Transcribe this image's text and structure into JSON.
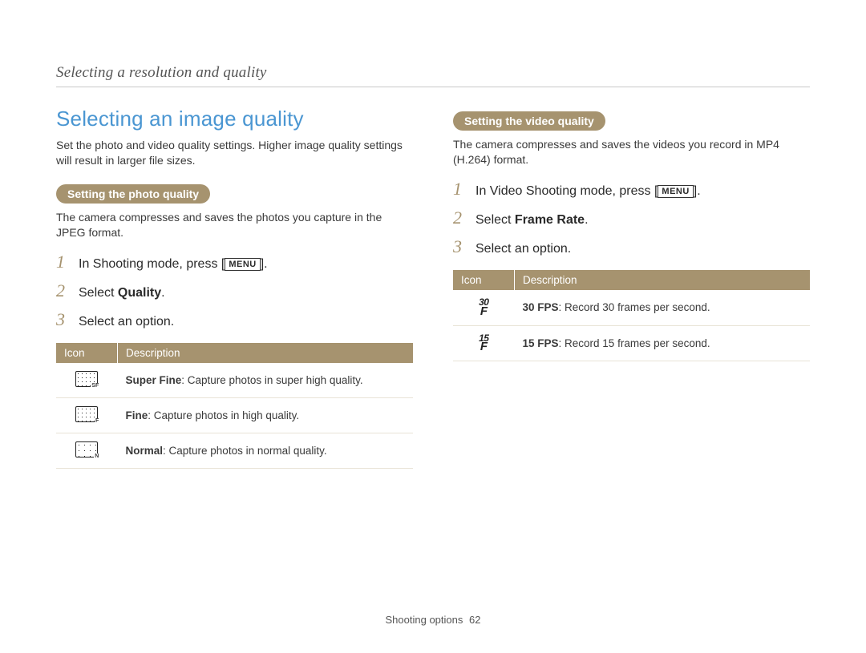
{
  "breadcrumb": "Selecting a resolution and quality",
  "left": {
    "title": "Selecting an image quality",
    "intro": "Set the photo and video quality settings. Higher image quality settings will result in larger file sizes.",
    "pill": "Setting the photo quality",
    "desc": "The camera compresses and saves the photos you capture in the JPEG format.",
    "steps": {
      "s1_prefix": "In Shooting mode, press [",
      "s1_suffix": "].",
      "s2_prefix": "Select ",
      "s2_bold": "Quality",
      "s2_suffix": ".",
      "s3": "Select an option."
    },
    "table": {
      "h1": "Icon",
      "h2": "Description",
      "rows": [
        {
          "icon_name": "quality-superfine-icon",
          "bold": "Super Fine",
          "rest": ": Capture photos in super high quality."
        },
        {
          "icon_name": "quality-fine-icon",
          "bold": "Fine",
          "rest": ": Capture photos in high quality."
        },
        {
          "icon_name": "quality-normal-icon",
          "bold": "Normal",
          "rest": ": Capture photos in normal quality."
        }
      ]
    }
  },
  "right": {
    "pill": "Setting the video quality",
    "desc": "The camera compresses and saves the videos you record in MP4 (H.264) format.",
    "steps": {
      "s1_prefix": "In Video Shooting mode, press [",
      "s1_suffix": "].",
      "s2_prefix": "Select ",
      "s2_bold": "Frame Rate",
      "s2_suffix": ".",
      "s3": "Select an option."
    },
    "table": {
      "h1": "Icon",
      "h2": "Description",
      "rows": [
        {
          "icon_name": "fps-30-icon",
          "icon_top": "30",
          "bold": "30 FPS",
          "rest": ": Record 30 frames per second."
        },
        {
          "icon_name": "fps-15-icon",
          "icon_top": "15",
          "bold": "15 FPS",
          "rest": ": Record 15 frames per second."
        }
      ]
    }
  },
  "menu_label": "MENU",
  "footer": {
    "section": "Shooting options",
    "page": "62"
  }
}
